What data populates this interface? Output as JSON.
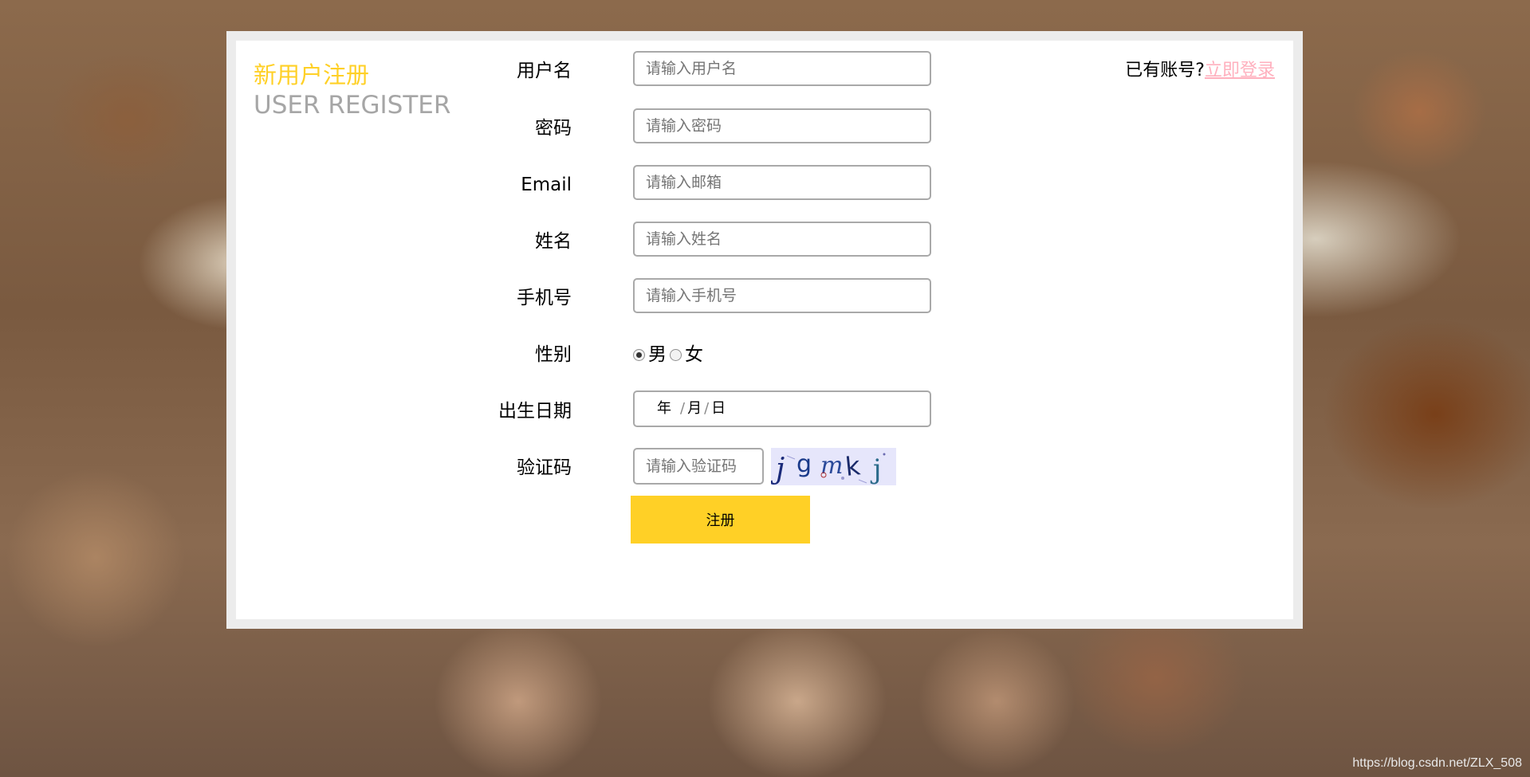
{
  "header": {
    "title_cn": "新用户注册",
    "title_en": "USER REGISTER",
    "login_prompt": "已有账号?",
    "login_link": "立即登录"
  },
  "form": {
    "fields": [
      {
        "label": "用户名",
        "placeholder": "请输入用户名",
        "value": ""
      },
      {
        "label": "密码",
        "placeholder": "请输入密码",
        "value": ""
      },
      {
        "label": "Email",
        "placeholder": "请输入邮箱",
        "value": ""
      },
      {
        "label": "姓名",
        "placeholder": "请输入姓名",
        "value": ""
      },
      {
        "label": "手机号",
        "placeholder": "请输入手机号",
        "value": ""
      }
    ],
    "gender": {
      "label": "性别",
      "options": [
        "男",
        "女"
      ],
      "selected": "男"
    },
    "birthday": {
      "label": "出生日期",
      "year": "年",
      "month": "月",
      "day": "日",
      "separator": "/"
    },
    "captcha": {
      "label": "验证码",
      "placeholder": "请输入验证码",
      "image_text": "jgmkj"
    },
    "submit_label": "注册"
  },
  "footer": {
    "watermark": "https://blog.csdn.net/ZLX_508"
  },
  "colors": {
    "accent": "#ffd026",
    "link": "#ffb0be",
    "subtitle": "#a6a6a6",
    "captcha_bg": "#e6e6fb"
  }
}
